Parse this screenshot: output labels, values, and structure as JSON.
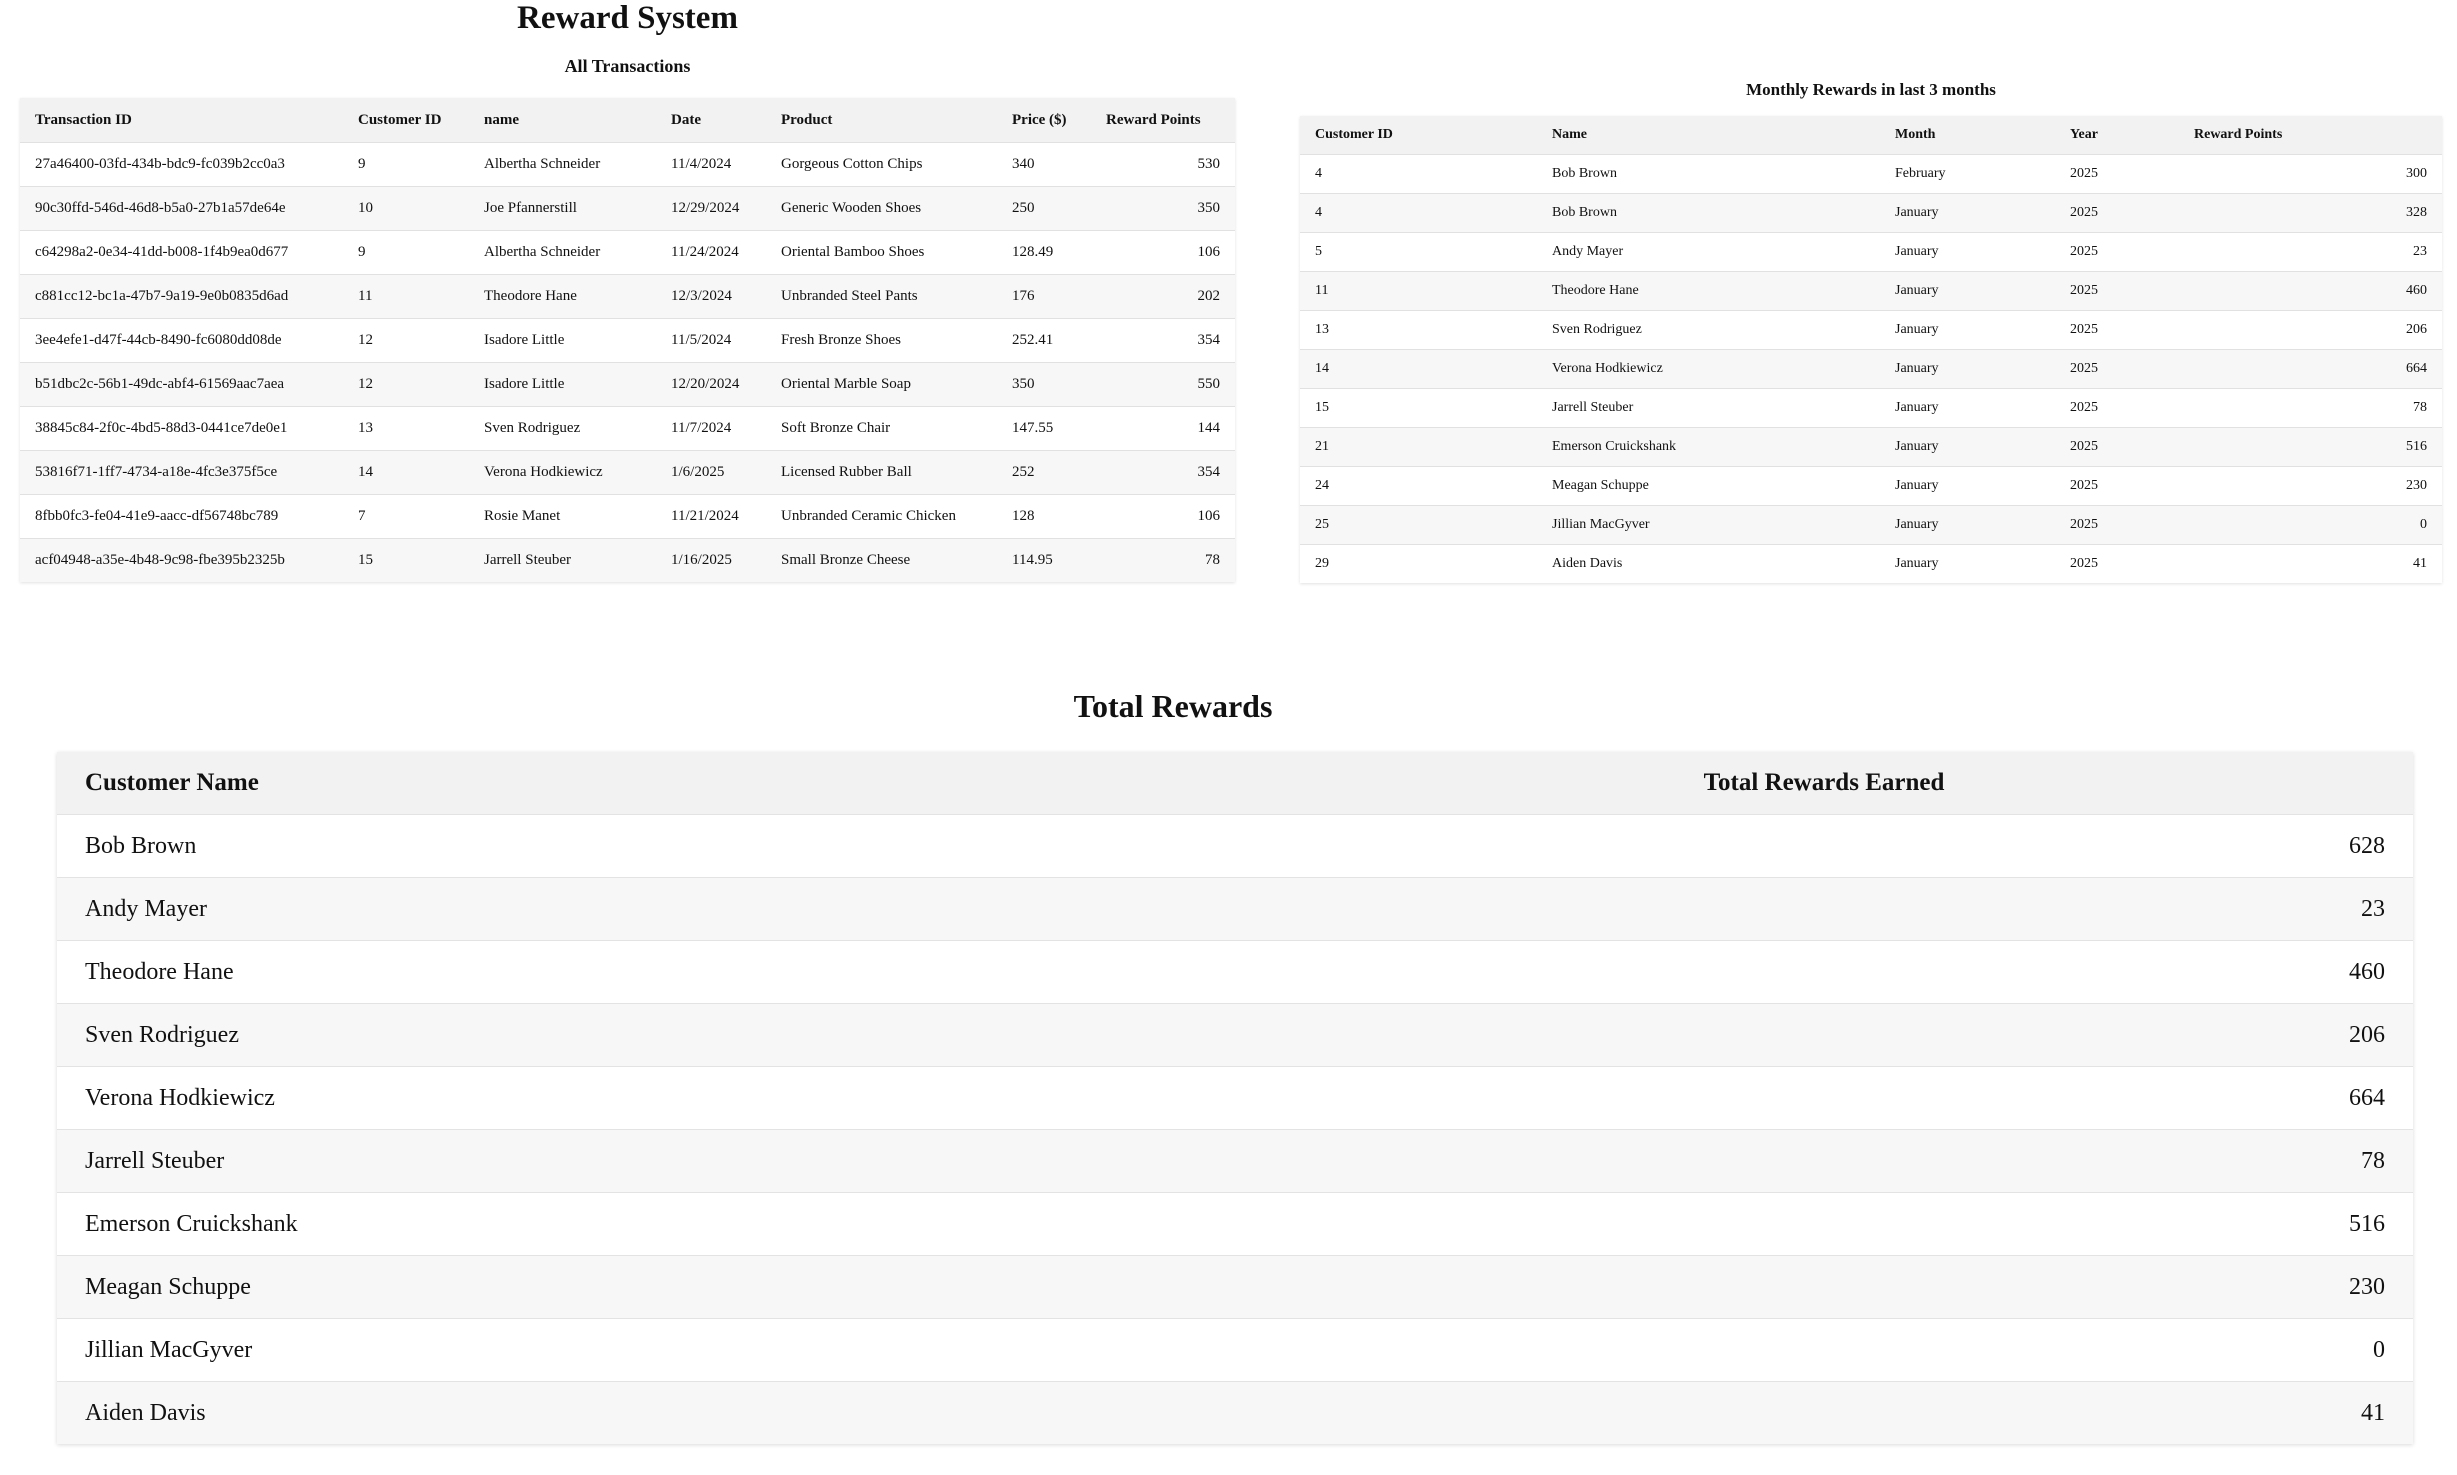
{
  "app": {
    "title": "Reward System"
  },
  "transactions": {
    "title": "All Transactions",
    "columns": [
      "Transaction ID",
      "Customer ID",
      "name",
      "Date",
      "Product",
      "Price ($)",
      "Reward Points"
    ],
    "rows": [
      [
        "27a46400-03fd-434b-bdc9-fc039b2cc0a3",
        "9",
        "Albertha Schneider",
        "11/4/2024",
        "Gorgeous Cotton Chips",
        "340",
        "530"
      ],
      [
        "90c30ffd-546d-46d8-b5a0-27b1a57de64e",
        "10",
        "Joe Pfannerstill",
        "12/29/2024",
        "Generic Wooden Shoes",
        "250",
        "350"
      ],
      [
        "c64298a2-0e34-41dd-b008-1f4b9ea0d677",
        "9",
        "Albertha Schneider",
        "11/24/2024",
        "Oriental Bamboo Shoes",
        "128.49",
        "106"
      ],
      [
        "c881cc12-bc1a-47b7-9a19-9e0b0835d6ad",
        "11",
        "Theodore Hane",
        "12/3/2024",
        "Unbranded Steel Pants",
        "176",
        "202"
      ],
      [
        "3ee4efe1-d47f-44cb-8490-fc6080dd08de",
        "12",
        "Isadore Little",
        "11/5/2024",
        "Fresh Bronze Shoes",
        "252.41",
        "354"
      ],
      [
        "b51dbc2c-56b1-49dc-abf4-61569aac7aea",
        "12",
        "Isadore Little",
        "12/20/2024",
        "Oriental Marble Soap",
        "350",
        "550"
      ],
      [
        "38845c84-2f0c-4bd5-88d3-0441ce7de0e1",
        "13",
        "Sven Rodriguez",
        "11/7/2024",
        "Soft Bronze Chair",
        "147.55",
        "144"
      ],
      [
        "53816f71-1ff7-4734-a18e-4fc3e375f5ce",
        "14",
        "Verona Hodkiewicz",
        "1/6/2025",
        "Licensed Rubber Ball",
        "252",
        "354"
      ],
      [
        "8fbb0fc3-fe04-41e9-aacc-df56748bc789",
        "7",
        "Rosie Manet",
        "11/21/2024",
        "Unbranded Ceramic Chicken",
        "128",
        "106"
      ],
      [
        "acf04948-a35e-4b48-9c98-fbe395b2325b",
        "15",
        "Jarrell Steuber",
        "1/16/2025",
        "Small Bronze Cheese",
        "114.95",
        "78"
      ]
    ]
  },
  "monthly": {
    "title": "Monthly Rewards in last 3 months",
    "columns": [
      "Customer ID",
      "Name",
      "Month",
      "Year",
      "Reward Points"
    ],
    "rows": [
      [
        "4",
        "Bob Brown",
        "February",
        "2025",
        "300"
      ],
      [
        "4",
        "Bob Brown",
        "January",
        "2025",
        "328"
      ],
      [
        "5",
        "Andy Mayer",
        "January",
        "2025",
        "23"
      ],
      [
        "11",
        "Theodore Hane",
        "January",
        "2025",
        "460"
      ],
      [
        "13",
        "Sven Rodriguez",
        "January",
        "2025",
        "206"
      ],
      [
        "14",
        "Verona Hodkiewicz",
        "January",
        "2025",
        "664"
      ],
      [
        "15",
        "Jarrell Steuber",
        "January",
        "2025",
        "78"
      ],
      [
        "21",
        "Emerson Cruickshank",
        "January",
        "2025",
        "516"
      ],
      [
        "24",
        "Meagan Schuppe",
        "January",
        "2025",
        "230"
      ],
      [
        "25",
        "Jillian MacGyver",
        "January",
        "2025",
        "0"
      ],
      [
        "29",
        "Aiden Davis",
        "January",
        "2025",
        "41"
      ]
    ]
  },
  "totals": {
    "title": "Total Rewards",
    "columns": [
      "Customer Name",
      "Total Rewards Earned"
    ],
    "rows": [
      [
        "Bob Brown",
        "628"
      ],
      [
        "Andy Mayer",
        "23"
      ],
      [
        "Theodore Hane",
        "460"
      ],
      [
        "Sven Rodriguez",
        "206"
      ],
      [
        "Verona Hodkiewicz",
        "664"
      ],
      [
        "Jarrell Steuber",
        "78"
      ],
      [
        "Emerson Cruickshank",
        "516"
      ],
      [
        "Meagan Schuppe",
        "230"
      ],
      [
        "Jillian MacGyver",
        "0"
      ],
      [
        "Aiden Davis",
        "41"
      ]
    ]
  }
}
